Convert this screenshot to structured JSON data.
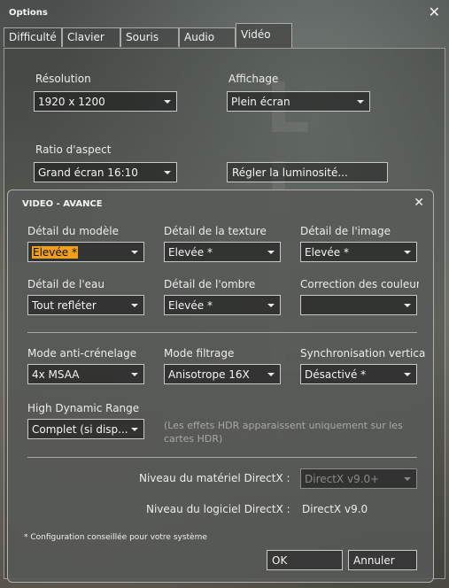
{
  "window": {
    "title": "Options",
    "close_glyph": "✕"
  },
  "tabs": [
    {
      "label": "Difficulté",
      "active": false
    },
    {
      "label": "Clavier",
      "active": false
    },
    {
      "label": "Souris",
      "active": false
    },
    {
      "label": "Audio",
      "active": false
    },
    {
      "label": "Vidéo",
      "active": true
    }
  ],
  "background_text": "L I F E",
  "video": {
    "resolution": {
      "label": "Résolution",
      "value": "1920 x 1200"
    },
    "display": {
      "label": "Affichage",
      "value": "Plein écran"
    },
    "aspect": {
      "label": "Ratio d'aspect",
      "value": "Grand écran 16:10"
    },
    "brightness_button": "Régler la luminosité..."
  },
  "advanced": {
    "title": "VIDEO - AVANCE",
    "close_glyph": "✕",
    "model_detail": {
      "label": "Détail du modèle",
      "value": "Elevée *"
    },
    "texture_detail": {
      "label": "Détail de la texture",
      "value": "Elevée *"
    },
    "image_detail": {
      "label": "Détail de l'image",
      "value": "Elevée *"
    },
    "water_detail": {
      "label": "Détail de l'eau",
      "value": "Tout refléter"
    },
    "shadow_detail": {
      "label": "Détail de l'ombre",
      "value": "Elevée *"
    },
    "color_correction": {
      "label": "Correction des couleurs",
      "value": ""
    },
    "antialias": {
      "label": "Mode anti-crénelage",
      "value": "4x MSAA"
    },
    "filtering": {
      "label": "Mode filtrage",
      "value": "Anisotrope 16X"
    },
    "vsync": {
      "label": "Synchronisation verticale",
      "value": "Désactivé *"
    },
    "hdr": {
      "label": "High Dynamic Range",
      "value": "Complet (si disp...",
      "note": "(Les effets HDR apparaissent uniquement sur les cartes HDR)"
    },
    "dx_hardware": {
      "label": "Niveau du matériel DirectX :",
      "value": "DirectX v9.0+"
    },
    "dx_software": {
      "label": "Niveau du logiciel DirectX :",
      "value": "DirectX v9.0"
    },
    "footnote": "* Configuration conseillée pour votre système",
    "ok": "OK",
    "cancel": "Annuler"
  },
  "colors": {
    "highlight": "#f0a020"
  },
  "icons": {
    "close": "close-icon",
    "dropdown": "chevron-down-icon"
  }
}
